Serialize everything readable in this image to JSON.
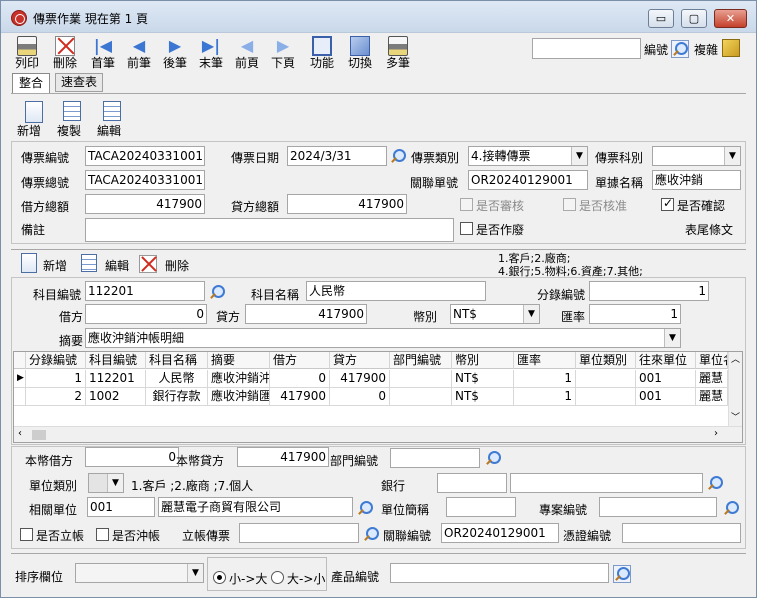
{
  "window": {
    "title": "傳票作業  現在第 1 頁",
    "minimize": "▭",
    "maximize": "▢",
    "close": "✕"
  },
  "toolbar": {
    "items": [
      {
        "label": "列印",
        "icon": "printer-icon"
      },
      {
        "label": "刪除",
        "icon": "delete-icon"
      },
      {
        "label": "首筆",
        "icon": "first-record-icon",
        "glyph": "|◀"
      },
      {
        "label": "前筆",
        "icon": "previous-record-icon",
        "glyph": "◀"
      },
      {
        "label": "後筆",
        "icon": "next-record-icon",
        "glyph": "▶"
      },
      {
        "label": "末筆",
        "icon": "last-record-icon",
        "glyph": "▶|"
      },
      {
        "label": "前頁",
        "icon": "previous-page-icon",
        "glyph": "◀"
      },
      {
        "label": "下頁",
        "icon": "next-page-icon",
        "glyph": "▶"
      },
      {
        "label": "功能",
        "icon": "function-icon"
      },
      {
        "label": "切換",
        "icon": "switch-icon"
      },
      {
        "label": "多筆",
        "icon": "multi-record-icon"
      }
    ],
    "search_value": "",
    "search_label": "編號",
    "copy_label": "複雜"
  },
  "tabs": [
    {
      "label": "整合"
    },
    {
      "label": "速查表"
    }
  ],
  "actions": {
    "new": "新增",
    "copy": "複製",
    "edit": "編輯"
  },
  "header": {
    "voucher_no_label": "傳票編號",
    "voucher_no": "TACA20240331001",
    "voucher_date_label": "傳票日期",
    "voucher_date": "2024/3/31",
    "voucher_type_label": "傳票類別",
    "voucher_type": "4.接轉傳票",
    "voucher_subject_label": "傳票科別",
    "voucher_subject": "",
    "voucher_total_no_label": "傳票總號",
    "voucher_total_no": "TACA20240331001",
    "related_doc_label": "關聯單號",
    "related_doc": "OR20240129001",
    "doc_name_label": "單據名稱",
    "doc_name": "應收沖銷",
    "debit_total_label": "借方總額",
    "debit_total": "417900",
    "credit_total_label": "貸方總額",
    "credit_total": "417900",
    "reviewed_label": "是否審核",
    "approved_label": "是否核准",
    "confirmed_label": "是否確認",
    "note_label": "備註",
    "note": "",
    "voided_label": "是否作廢",
    "footer_text_label": "表尾條文"
  },
  "detail_actions": {
    "new": "新增",
    "edit": "編輯",
    "delete": "刪除"
  },
  "hint": {
    "line1": "1.客戶;2.廠商;",
    "line2": "4.銀行;5.物料;6.資產;7.其他;"
  },
  "detail": {
    "account_code_label": "科目編號",
    "account_code": "112201",
    "account_name_label": "科目名稱",
    "account_name": "人民幣",
    "entry_no_label": "分錄編號",
    "entry_no": "1",
    "debit_label": "借方",
    "debit": "0",
    "credit_label": "貸方",
    "credit": "417900",
    "currency_label": "幣別",
    "currency": "NT$",
    "rate_label": "匯率",
    "rate": "1",
    "summary_label": "摘要",
    "summary": "應收沖銷沖帳明細"
  },
  "grid": {
    "columns": [
      "分錄編號",
      "科目編號",
      "科目名稱",
      "摘要",
      "借方",
      "貸方",
      "部門編號",
      "幣別",
      "匯率",
      "單位類別",
      "往來單位",
      "單位名"
    ],
    "rows": [
      [
        "1",
        "112201",
        "人民幣",
        "應收沖銷沖",
        "0",
        "417900",
        "",
        "NT$",
        "1",
        "",
        "001",
        "麗慧"
      ],
      [
        "2",
        "1002",
        "銀行存款",
        "應收沖銷匯",
        "417900",
        "0",
        "",
        "NT$",
        "1",
        "",
        "001",
        "麗慧"
      ]
    ]
  },
  "bottom": {
    "local_debit_label": "本幣借方",
    "local_debit": "0",
    "local_credit_label": "本幣貸方",
    "local_credit": "417900",
    "dept_label": "部門編號",
    "dept": "",
    "unit_type_label": "單位類別",
    "unit_type": "",
    "unit_type_hint": "1.客戶 ;2.廠商 ;7.個人",
    "bank_label": "銀行",
    "bank": "",
    "bank2": "",
    "related_unit_label": "相關單位",
    "related_unit": "001",
    "related_unit_name": "麗慧電子商貿有限公司",
    "unit_short_label": "單位簡稱",
    "unit_short": "",
    "project_label": "專案編號",
    "project": "",
    "posted_label": "是否立帳",
    "offset_label": "是否沖帳",
    "ledger_voucher_label": "立帳傳票",
    "ledger_voucher": "",
    "related_code_label": "關聯編號",
    "related_code": "OR20240129001",
    "proof_label": "憑證編號",
    "proof": ""
  },
  "footer": {
    "sort_label": "排序欄位",
    "sort_value": "",
    "asc_label": "小->大",
    "desc_label": "大->小",
    "product_label": "產品編號",
    "product": ""
  }
}
